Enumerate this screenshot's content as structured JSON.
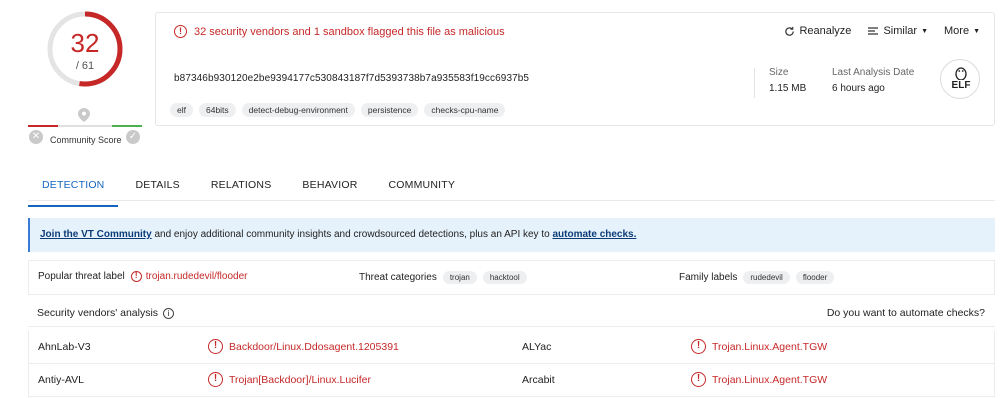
{
  "score": {
    "detections": "32",
    "total": "/ 61",
    "community_label": "Community Score",
    "ratio": 0.5246
  },
  "summary": {
    "flag_text": "32 security vendors and 1 sandbox flagged this file as malicious",
    "actions": {
      "reanalyze": "Reanalyze",
      "similar": "Similar",
      "more": "More"
    },
    "hash": "b87346b930120e2be9394177c530843187f7d5393738b7a935583f19cc6937b5",
    "tags": [
      "elf",
      "64bits",
      "detect-debug-environment",
      "persistence",
      "checks-cpu-name"
    ],
    "size_label": "Size",
    "size_value": "1.15 MB",
    "last_analysis_label": "Last Analysis Date",
    "last_analysis_value": "6 hours ago",
    "file_type": "ELF"
  },
  "tabs": [
    "DETECTION",
    "DETAILS",
    "RELATIONS",
    "BEHAVIOR",
    "COMMUNITY"
  ],
  "banner": {
    "link1": "Join the VT Community",
    "text": " and enjoy additional community insights and crowdsourced detections, plus an API key to ",
    "link2": "automate checks."
  },
  "threat": {
    "popular_label": "Popular threat label",
    "popular_value": "trojan.rudedevil/flooder",
    "categories_label": "Threat categories",
    "categories": [
      "trojan",
      "hacktool"
    ],
    "family_label": "Family labels",
    "families": [
      "rudedevil",
      "flooder"
    ]
  },
  "analysis": {
    "title": "Security vendors' analysis",
    "automate": "Do you want to automate checks?",
    "rows": [
      {
        "v1": "AhnLab-V3",
        "r1": "Backdoor/Linux.Ddosagent.1205391",
        "v2": "ALYac",
        "r2": "Trojan.Linux.Agent.TGW"
      },
      {
        "v1": "Antiy-AVL",
        "r1": "Trojan[Backdoor]/Linux.Lucifer",
        "v2": "Arcabit",
        "r2": "Trojan.Linux.Agent.TGW"
      }
    ]
  },
  "colors": {
    "malicious": "#c62828",
    "accent": "#1565c0",
    "banner_bg": "#e6f2fb"
  }
}
